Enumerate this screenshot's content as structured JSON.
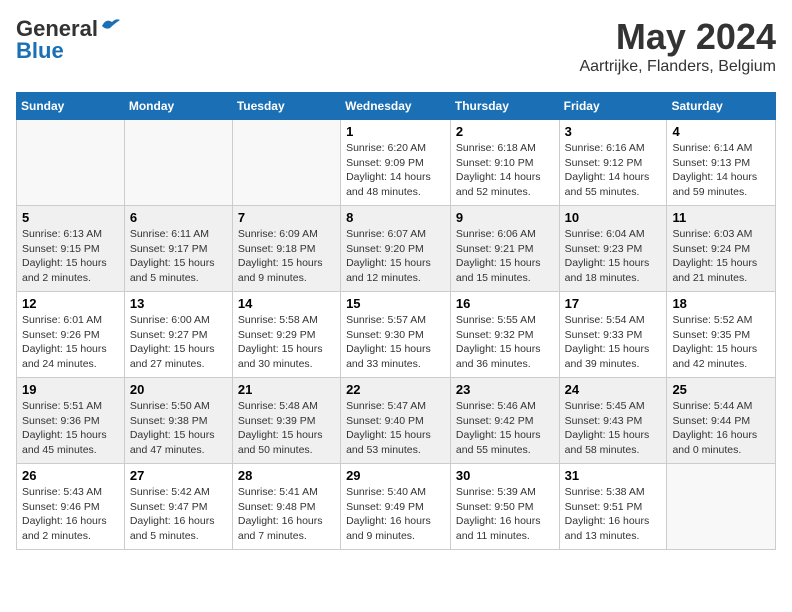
{
  "header": {
    "logo_general": "General",
    "logo_blue": "Blue",
    "month": "May 2024",
    "location": "Aartrijke, Flanders, Belgium"
  },
  "weekdays": [
    "Sunday",
    "Monday",
    "Tuesday",
    "Wednesday",
    "Thursday",
    "Friday",
    "Saturday"
  ],
  "weeks": [
    [
      {
        "day": "",
        "info": ""
      },
      {
        "day": "",
        "info": ""
      },
      {
        "day": "",
        "info": ""
      },
      {
        "day": "1",
        "info": "Sunrise: 6:20 AM\nSunset: 9:09 PM\nDaylight: 14 hours\nand 48 minutes."
      },
      {
        "day": "2",
        "info": "Sunrise: 6:18 AM\nSunset: 9:10 PM\nDaylight: 14 hours\nand 52 minutes."
      },
      {
        "day": "3",
        "info": "Sunrise: 6:16 AM\nSunset: 9:12 PM\nDaylight: 14 hours\nand 55 minutes."
      },
      {
        "day": "4",
        "info": "Sunrise: 6:14 AM\nSunset: 9:13 PM\nDaylight: 14 hours\nand 59 minutes."
      }
    ],
    [
      {
        "day": "5",
        "info": "Sunrise: 6:13 AM\nSunset: 9:15 PM\nDaylight: 15 hours\nand 2 minutes."
      },
      {
        "day": "6",
        "info": "Sunrise: 6:11 AM\nSunset: 9:17 PM\nDaylight: 15 hours\nand 5 minutes."
      },
      {
        "day": "7",
        "info": "Sunrise: 6:09 AM\nSunset: 9:18 PM\nDaylight: 15 hours\nand 9 minutes."
      },
      {
        "day": "8",
        "info": "Sunrise: 6:07 AM\nSunset: 9:20 PM\nDaylight: 15 hours\nand 12 minutes."
      },
      {
        "day": "9",
        "info": "Sunrise: 6:06 AM\nSunset: 9:21 PM\nDaylight: 15 hours\nand 15 minutes."
      },
      {
        "day": "10",
        "info": "Sunrise: 6:04 AM\nSunset: 9:23 PM\nDaylight: 15 hours\nand 18 minutes."
      },
      {
        "day": "11",
        "info": "Sunrise: 6:03 AM\nSunset: 9:24 PM\nDaylight: 15 hours\nand 21 minutes."
      }
    ],
    [
      {
        "day": "12",
        "info": "Sunrise: 6:01 AM\nSunset: 9:26 PM\nDaylight: 15 hours\nand 24 minutes."
      },
      {
        "day": "13",
        "info": "Sunrise: 6:00 AM\nSunset: 9:27 PM\nDaylight: 15 hours\nand 27 minutes."
      },
      {
        "day": "14",
        "info": "Sunrise: 5:58 AM\nSunset: 9:29 PM\nDaylight: 15 hours\nand 30 minutes."
      },
      {
        "day": "15",
        "info": "Sunrise: 5:57 AM\nSunset: 9:30 PM\nDaylight: 15 hours\nand 33 minutes."
      },
      {
        "day": "16",
        "info": "Sunrise: 5:55 AM\nSunset: 9:32 PM\nDaylight: 15 hours\nand 36 minutes."
      },
      {
        "day": "17",
        "info": "Sunrise: 5:54 AM\nSunset: 9:33 PM\nDaylight: 15 hours\nand 39 minutes."
      },
      {
        "day": "18",
        "info": "Sunrise: 5:52 AM\nSunset: 9:35 PM\nDaylight: 15 hours\nand 42 minutes."
      }
    ],
    [
      {
        "day": "19",
        "info": "Sunrise: 5:51 AM\nSunset: 9:36 PM\nDaylight: 15 hours\nand 45 minutes."
      },
      {
        "day": "20",
        "info": "Sunrise: 5:50 AM\nSunset: 9:38 PM\nDaylight: 15 hours\nand 47 minutes."
      },
      {
        "day": "21",
        "info": "Sunrise: 5:48 AM\nSunset: 9:39 PM\nDaylight: 15 hours\nand 50 minutes."
      },
      {
        "day": "22",
        "info": "Sunrise: 5:47 AM\nSunset: 9:40 PM\nDaylight: 15 hours\nand 53 minutes."
      },
      {
        "day": "23",
        "info": "Sunrise: 5:46 AM\nSunset: 9:42 PM\nDaylight: 15 hours\nand 55 minutes."
      },
      {
        "day": "24",
        "info": "Sunrise: 5:45 AM\nSunset: 9:43 PM\nDaylight: 15 hours\nand 58 minutes."
      },
      {
        "day": "25",
        "info": "Sunrise: 5:44 AM\nSunset: 9:44 PM\nDaylight: 16 hours\nand 0 minutes."
      }
    ],
    [
      {
        "day": "26",
        "info": "Sunrise: 5:43 AM\nSunset: 9:46 PM\nDaylight: 16 hours\nand 2 minutes."
      },
      {
        "day": "27",
        "info": "Sunrise: 5:42 AM\nSunset: 9:47 PM\nDaylight: 16 hours\nand 5 minutes."
      },
      {
        "day": "28",
        "info": "Sunrise: 5:41 AM\nSunset: 9:48 PM\nDaylight: 16 hours\nand 7 minutes."
      },
      {
        "day": "29",
        "info": "Sunrise: 5:40 AM\nSunset: 9:49 PM\nDaylight: 16 hours\nand 9 minutes."
      },
      {
        "day": "30",
        "info": "Sunrise: 5:39 AM\nSunset: 9:50 PM\nDaylight: 16 hours\nand 11 minutes."
      },
      {
        "day": "31",
        "info": "Sunrise: 5:38 AM\nSunset: 9:51 PM\nDaylight: 16 hours\nand 13 minutes."
      },
      {
        "day": "",
        "info": ""
      }
    ]
  ]
}
